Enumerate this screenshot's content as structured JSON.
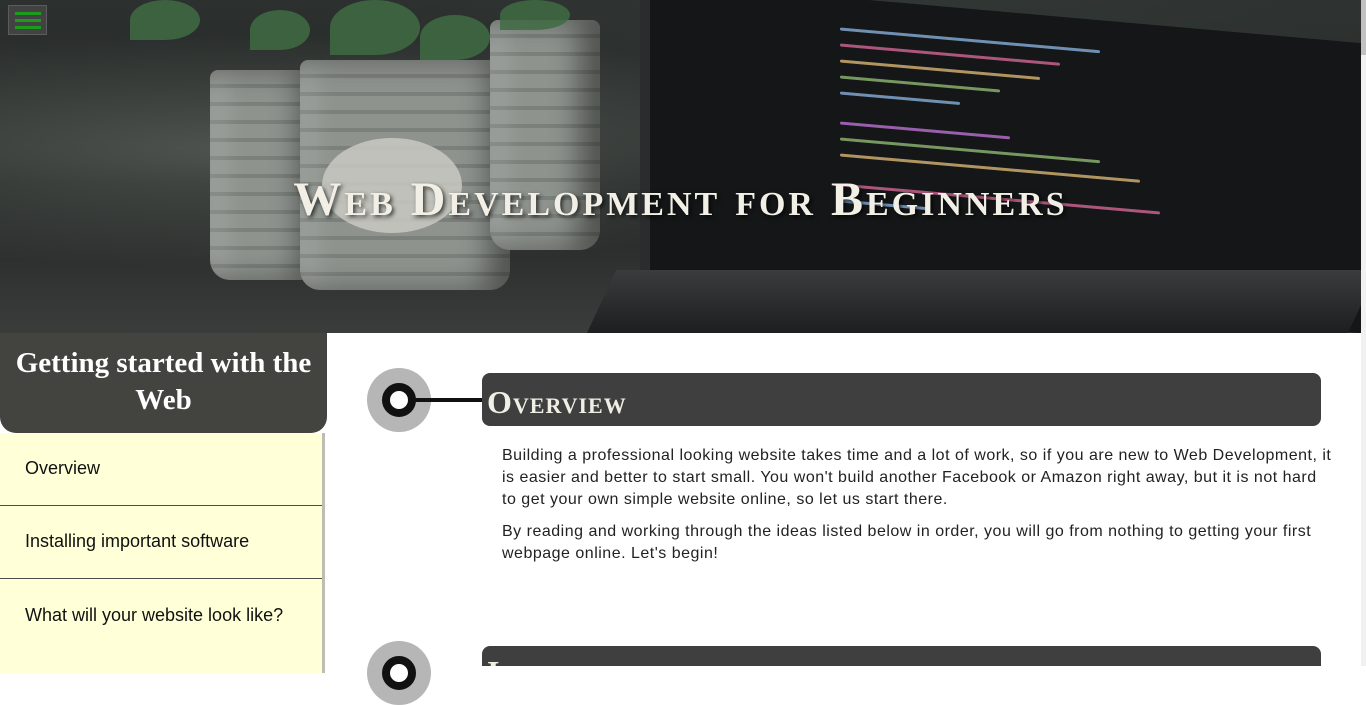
{
  "hero": {
    "title": "Web Development for Beginners"
  },
  "menu": {
    "icon": "hamburger-menu-icon",
    "accent_color": "#1d9b1d"
  },
  "sidebar": {
    "title": "Getting started with the Web",
    "items": [
      {
        "label": "Overview"
      },
      {
        "label": "Installing important software"
      },
      {
        "label": "What will your website look like?"
      }
    ]
  },
  "main": {
    "sections": [
      {
        "heading": "Overview",
        "paragraphs": [
          "Building a professional looking website takes time and a lot of work, so if you are new to Web Development, it is easier and better to start small. You won't build another Facebook or Amazon right away, but it is not hard to get your own simple website online, so let us start there.",
          "By reading and working through the ideas listed below in order, you will go from nothing to getting your first webpage online. Let's begin!"
        ]
      },
      {
        "heading": "Installing important software"
      }
    ]
  },
  "colors": {
    "sidebar_header_bg": "#434440",
    "sidebar_list_bg": "#ffffd8",
    "section_header_bg": "#3f3f3f"
  }
}
